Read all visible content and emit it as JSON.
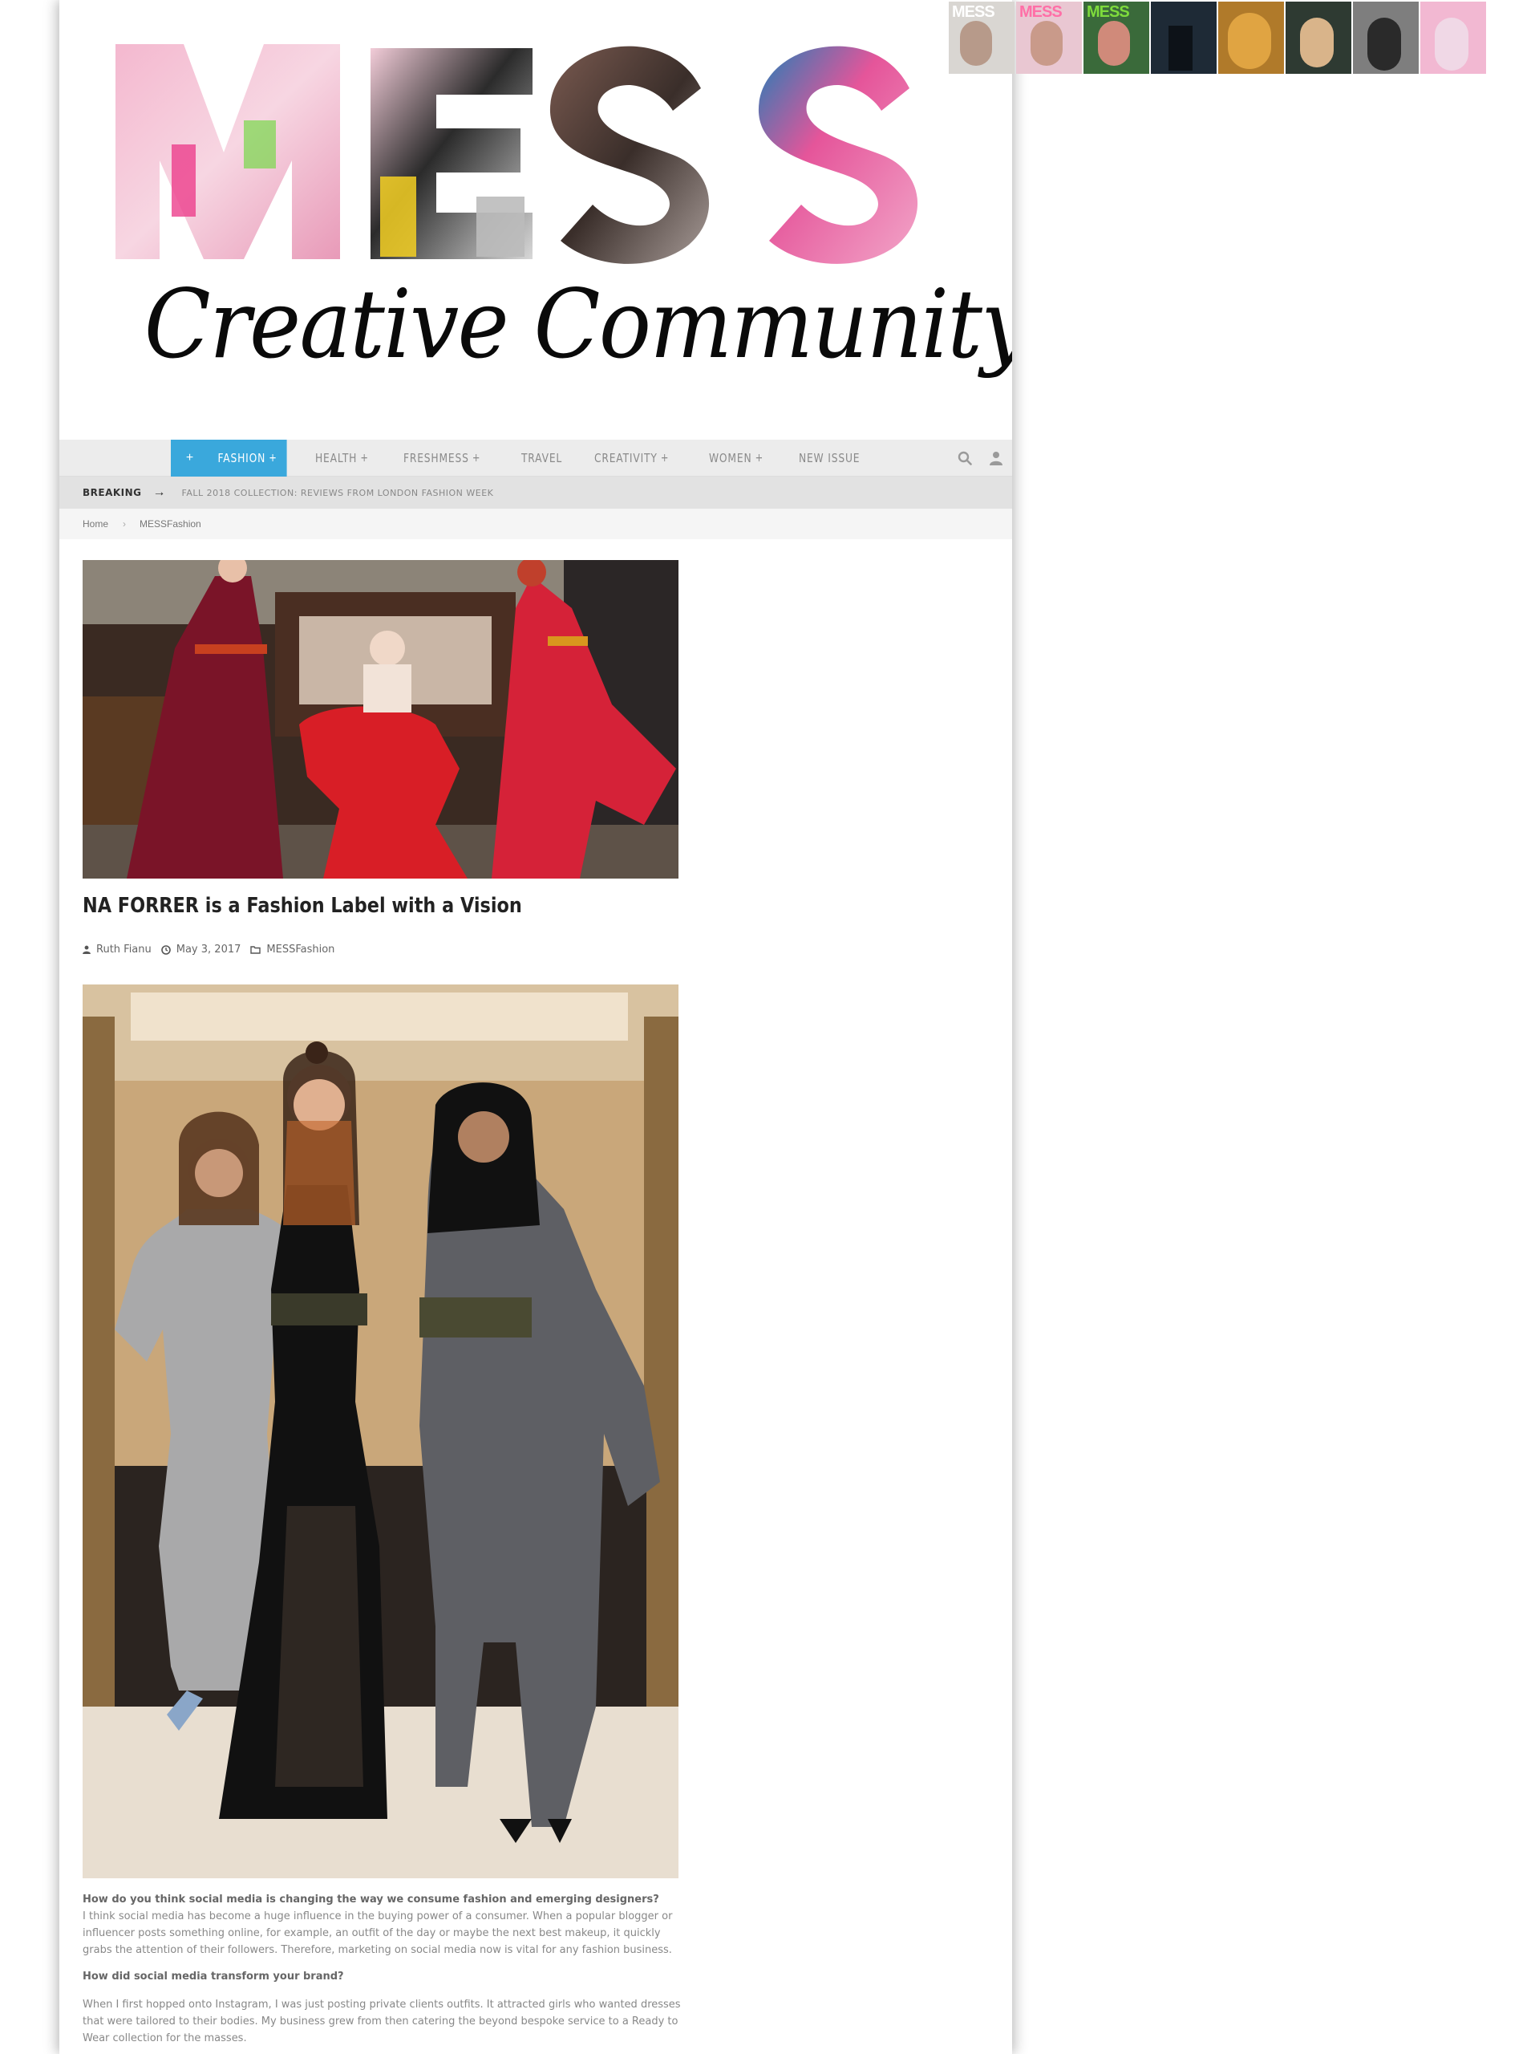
{
  "logo": {
    "wordmark": "MESS",
    "tagline": "Creative Community"
  },
  "covers": [
    {
      "title": "MESS",
      "color": "#ffffff"
    },
    {
      "title": "MESS",
      "color": "#ff6fa7"
    },
    {
      "title": "MESS",
      "color": "#7edb3c"
    },
    {
      "title": "",
      "color": ""
    },
    {
      "title": "",
      "color": ""
    },
    {
      "title": "",
      "color": ""
    },
    {
      "title": "",
      "color": ""
    },
    {
      "title": "",
      "color": ""
    }
  ],
  "nav": {
    "home_icon": "plus-icon",
    "items": [
      {
        "label": "FASHION",
        "has_plus": true,
        "active": true
      },
      {
        "label": "HEALTH",
        "has_plus": true
      },
      {
        "label": "FRESHMESS",
        "has_plus": true
      },
      {
        "label": "TRAVEL",
        "has_plus": false
      },
      {
        "label": "CREATIVITY",
        "has_plus": true
      },
      {
        "label": "WOMEN",
        "has_plus": true
      },
      {
        "label": "NEW ISSUE",
        "has_plus": false
      }
    ],
    "plus_glyph": "+",
    "accent": "#3aa8dc"
  },
  "breaking": {
    "label": "BREAKING",
    "arrow": "→",
    "headline": "FALL 2018 COLLECTION: REVIEWS FROM LONDON FASHION WEEK"
  },
  "breadcrumb": {
    "home": "Home",
    "sep": "›",
    "current": "MESSFashion"
  },
  "article": {
    "title": "NA FORRER is a Fashion Label with a Vision",
    "author": "Ruth Fianu",
    "date": "May 3, 2017",
    "category": "MESSFashion",
    "q1": "How do you think social media is changing the way we consume fashion and emerging designers?",
    "a1_l1": "I think social media has become a huge influence in the buying power of a consumer. When a popular blogger or",
    "a1_l2": "influencer posts something online, for example, an outfit of the day or maybe the next best makeup, it quickly",
    "a1_l3": "grabs the attention of their followers. Therefore, marketing on social media now is vital for any fashion business.",
    "q2": "How did social media transform your brand?",
    "a2_l1": "When I first hopped onto Instagram, I was just posting private clients outfits. It attracted girls who wanted dresses",
    "a2_l2": "that were tailored to their bodies. My business grew from then catering the beyond bespoke service to a Ready to",
    "a2_l3": "Wear collection for the masses."
  }
}
